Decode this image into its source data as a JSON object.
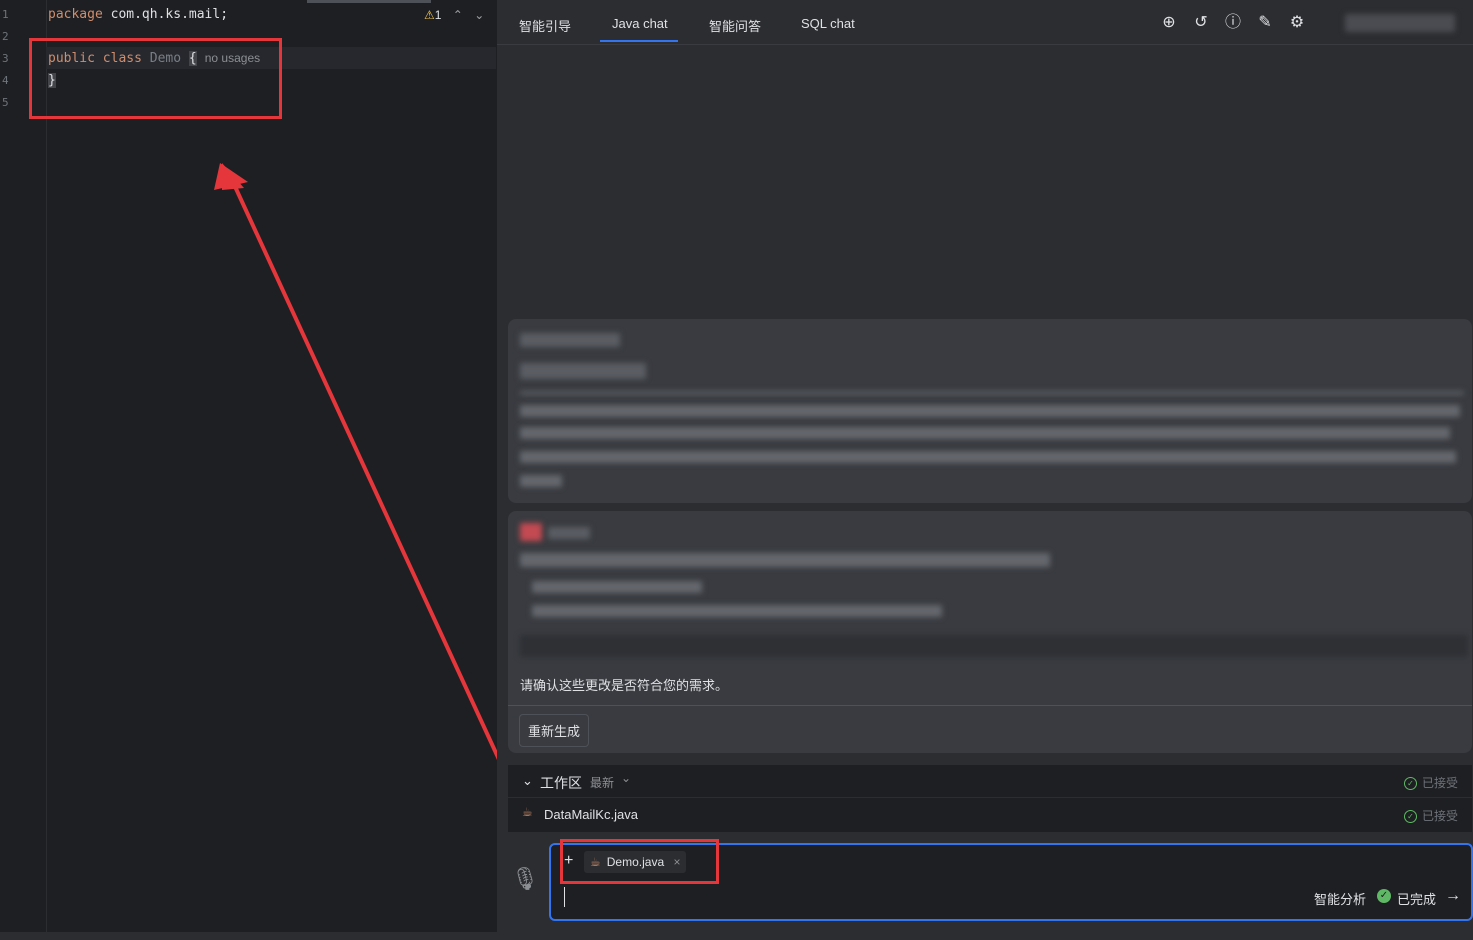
{
  "editor": {
    "line_numbers": [
      "1",
      "2",
      "3",
      "4",
      "5"
    ],
    "lines": {
      "l1_kw": "package",
      "l1_rest": " com.qh.ks.mail;",
      "l3_kw1": "public",
      "l3_kw2": "class",
      "l3_cls": "Demo",
      "l3_brace": "{",
      "l3_inlay": "no usages",
      "l4": "}"
    },
    "warning_count": "1"
  },
  "chat": {
    "tabs": [
      "智能引导",
      "Java chat",
      "智能问答",
      "SQL chat"
    ],
    "active_tab": "Java chat",
    "toolbar_icons": [
      "add-icon",
      "history-icon",
      "help-icon",
      "edit-icon",
      "settings-icon"
    ],
    "confirm_text": "请确认这些更改是否符合您的需求。",
    "regenerate_label": "重新生成",
    "workspace": {
      "title": "工作区",
      "filter": "最新",
      "status_header": "已接受",
      "files": [
        {
          "name": "DataMailKc.java",
          "status": "已接受"
        }
      ]
    },
    "input": {
      "attachment": "Demo.java",
      "mode_label": "智能分析",
      "status_label": "已完成"
    }
  },
  "colors": {
    "accent": "#3574f0",
    "keyword": "#cf8e6d",
    "annotation": "#e5363b",
    "success": "#5fb865"
  }
}
